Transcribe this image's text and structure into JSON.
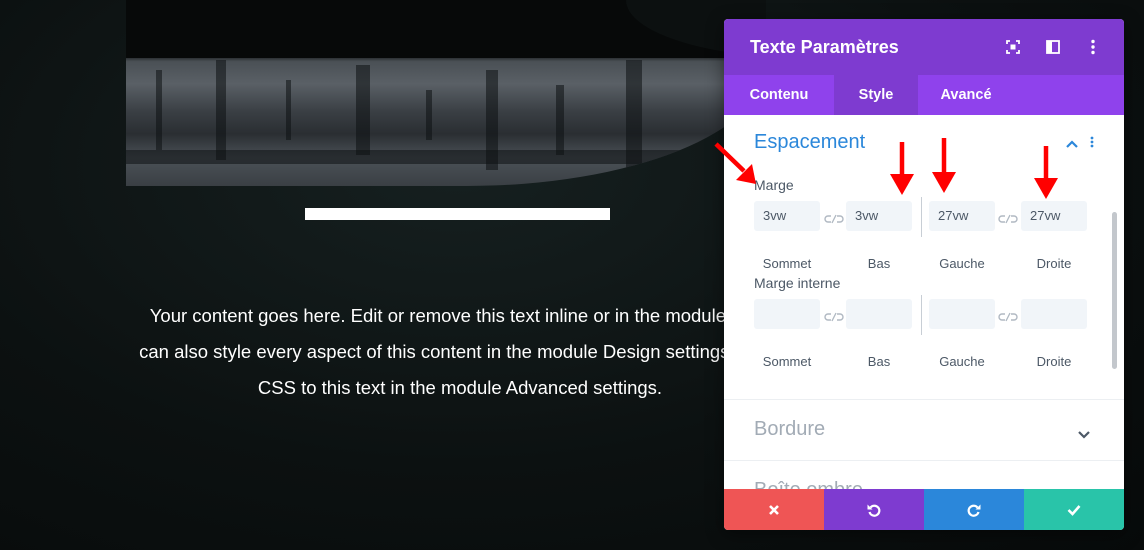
{
  "content": {
    "body_text_lines": [
      "Your content goes here. Edit or remove this text inline or in the module Cont",
      "can also style every aspect of this content in the module Design settings and e",
      "CSS to this text in the module Advanced settings."
    ]
  },
  "panel": {
    "title": "Texte Paramètres",
    "header_icons": [
      "expand-icon",
      "split-icon",
      "more-vertical-icon"
    ],
    "tabs": [
      {
        "label": "Contenu",
        "active": false
      },
      {
        "label": "Style",
        "active": true
      },
      {
        "label": "Avancé",
        "active": false
      }
    ],
    "section_open": {
      "title": "Espacement",
      "groups": [
        {
          "label": "Marge",
          "fields": [
            {
              "label": "Sommet",
              "value": "3vw"
            },
            {
              "label": "Bas",
              "value": "3vw"
            },
            {
              "label": "Gauche",
              "value": "27vw"
            },
            {
              "label": "Droite",
              "value": "27vw"
            }
          ]
        },
        {
          "label": "Marge interne",
          "fields": [
            {
              "label": "Sommet",
              "value": ""
            },
            {
              "label": "Bas",
              "value": ""
            },
            {
              "label": "Gauche",
              "value": ""
            },
            {
              "label": "Droite",
              "value": ""
            }
          ]
        }
      ]
    },
    "sections_collapsed": [
      "Bordure",
      "Boîte ombre"
    ],
    "footer_buttons": [
      "close-icon",
      "undo-icon",
      "redo-icon",
      "check-icon"
    ]
  },
  "colors": {
    "header_purple": "#7e3bd0",
    "tabs_purple": "#8f42ec",
    "accent_blue": "#2b87da",
    "cancel_red": "#ef5555",
    "save_green": "#29c4a9",
    "annotation_red": "#ff0000"
  }
}
